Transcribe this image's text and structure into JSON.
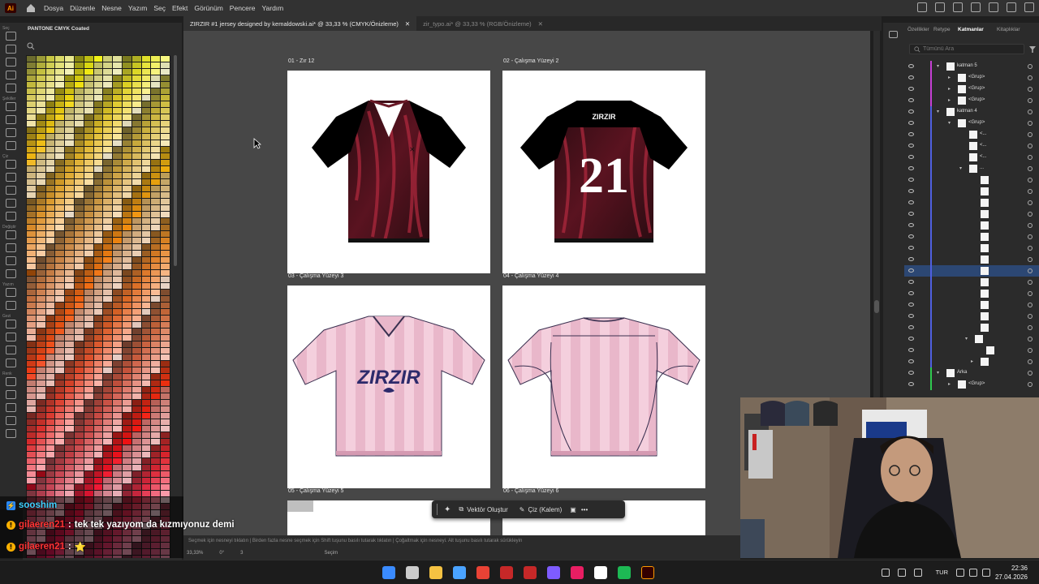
{
  "app": {
    "logo": "Ai"
  },
  "menu": [
    "Dosya",
    "Düzenle",
    "Nesne",
    "Yazım",
    "Seç",
    "Efekt",
    "Görünüm",
    "Pencere",
    "Yardım"
  ],
  "tabs": [
    {
      "label": "ZIRZIR #1 jersey designed by kemaldowski.ai* @ 33,33 % (CMYK/Önizleme)",
      "active": true
    },
    {
      "label": "zir_typo.ai* @ 33,33 % (RGB/Önizleme)",
      "active": false
    }
  ],
  "tool_labels": [
    "Seç",
    "Şekiller",
    "Çiz",
    "Değiştir",
    "Yazım",
    "Gezi",
    "Renk"
  ],
  "swatches": {
    "title": "PANTONE CMYK Coated"
  },
  "artboards": [
    {
      "label": "01 - Zır 12",
      "kind": "front-dark"
    },
    {
      "label": "02 - Çalışma Yüzeyi 2",
      "kind": "back-dark",
      "number": "21",
      "logo": "ZIRZIR"
    },
    {
      "label": "03 - Çalışma Yüzeyi 3",
      "kind": "front-pink",
      "logo": "ZIRZIR"
    },
    {
      "label": "04 - Çalışma Yüzeyi 4",
      "kind": "back-pink"
    },
    {
      "label": "05 - Çalışma Yüzeyi 5",
      "kind": "blank"
    },
    {
      "label": "06 - Çalışma Yüzeyi 6",
      "kind": "blank"
    }
  ],
  "float_toolbar": {
    "vector_label": "Vektör Oluştur",
    "draw_label": "Çiz (Kalem)"
  },
  "status": {
    "hint": "Seçmek için nesneyi tıklatın  |  Birden fazla nesne seçmek için Shift tuşunu basılı tutarak tıklatın  |  Çoğaltmak için nesneyi. Alt tuşunu basılı tutarak sürükleyin",
    "zoom": "33,33%",
    "angle": "0°",
    "artboard_index": "3",
    "mode": "Seçim"
  },
  "layers_panel": {
    "tabs": [
      "Özellikler",
      "Retype",
      "Katmanlar",
      "Kitaplıklar"
    ],
    "active_tab": "Katmanlar",
    "search_placeholder": "Tümünü Ara",
    "rows": [
      {
        "name": "katman 5",
        "indent": 0,
        "color": "#c63fd4",
        "arrow": "v",
        "thumb": true
      },
      {
        "name": "<Grup>",
        "indent": 2,
        "color": "#c63fd4",
        "arrow": ">",
        "thumb": true
      },
      {
        "name": "<Grup>",
        "indent": 2,
        "color": "#c63fd4",
        "arrow": ">",
        "thumb": true
      },
      {
        "name": "<Grup>",
        "indent": 2,
        "color": "#c63fd4",
        "arrow": ">",
        "thumb": true
      },
      {
        "name": "katman 4",
        "indent": 0,
        "color": "#4f5fe0",
        "arrow": "v",
        "thumb": true
      },
      {
        "name": "<Grup>",
        "indent": 2,
        "color": "#4f5fe0",
        "arrow": "v",
        "thumb": true
      },
      {
        "name": "<...",
        "indent": 4,
        "color": "#4f5fe0",
        "arrow": "",
        "thumb": true
      },
      {
        "name": "<...",
        "indent": 4,
        "color": "#4f5fe0",
        "arrow": "",
        "thumb": true
      },
      {
        "name": "<...",
        "indent": 4,
        "color": "#4f5fe0",
        "arrow": "",
        "thumb": true
      },
      {
        "name": "...",
        "indent": 4,
        "color": "#4f5fe0",
        "arrow": "v",
        "thumb": true
      },
      {
        "name": "",
        "indent": 6,
        "color": "#4f5fe0",
        "arrow": "",
        "thumb": true
      },
      {
        "name": "",
        "indent": 6,
        "color": "#4f5fe0",
        "arrow": "",
        "thumb": true
      },
      {
        "name": "",
        "indent": 6,
        "color": "#4f5fe0",
        "arrow": "",
        "thumb": true
      },
      {
        "name": "",
        "indent": 6,
        "color": "#4f5fe0",
        "arrow": "",
        "thumb": true
      },
      {
        "name": "",
        "indent": 6,
        "color": "#4f5fe0",
        "arrow": "",
        "thumb": true
      },
      {
        "name": "",
        "indent": 6,
        "color": "#4f5fe0",
        "arrow": "",
        "thumb": true
      },
      {
        "name": "",
        "indent": 6,
        "color": "#4f5fe0",
        "arrow": "",
        "thumb": true
      },
      {
        "name": "",
        "indent": 6,
        "color": "#4f5fe0",
        "arrow": "",
        "thumb": true
      },
      {
        "name": "",
        "indent": 6,
        "color": "#4f5fe0",
        "arrow": "",
        "thumb": true,
        "selected": true
      },
      {
        "name": "",
        "indent": 6,
        "color": "#4f5fe0",
        "arrow": "",
        "thumb": true
      },
      {
        "name": "",
        "indent": 6,
        "color": "#4f5fe0",
        "arrow": "",
        "thumb": true
      },
      {
        "name": "",
        "indent": 6,
        "color": "#4f5fe0",
        "arrow": "",
        "thumb": true
      },
      {
        "name": "",
        "indent": 6,
        "color": "#4f5fe0",
        "arrow": "",
        "thumb": true
      },
      {
        "name": "",
        "indent": 6,
        "color": "#4f5fe0",
        "arrow": "",
        "thumb": true
      },
      {
        "name": "",
        "indent": 5,
        "color": "#4f5fe0",
        "arrow": "v",
        "thumb": true
      },
      {
        "name": "",
        "indent": 7,
        "color": "#4f5fe0",
        "arrow": "",
        "thumb": true
      },
      {
        "name": "",
        "indent": 6,
        "color": "#4f5fe0",
        "arrow": ">",
        "thumb": true
      },
      {
        "name": "Arka",
        "indent": 0,
        "color": "#2fc84f",
        "arrow": "v",
        "thumb": true
      },
      {
        "name": "<Grup>",
        "indent": 2,
        "color": "#2fc84f",
        "arrow": ">",
        "thumb": true
      }
    ]
  },
  "chat": [
    {
      "user": "sooshim",
      "badge": "",
      "message": ""
    },
    {
      "user": "gilaeren21",
      "badge": "!",
      "message": "tek tek yazıyom da kızmıyonuz demi"
    },
    {
      "user": "gilaeren21",
      "badge": "!",
      "message": "⭐"
    }
  ],
  "taskbar": {
    "language": "TUR",
    "time": "22:36",
    "date": "27.04.2026",
    "apps": [
      "windows-start",
      "search",
      "file-explorer",
      "photos",
      "chrome",
      "game-a",
      "game-b",
      "affinity",
      "media",
      "notion",
      "spotify",
      "illustrator"
    ]
  },
  "colors": {
    "accent": "#4f5fe0",
    "jersey_dark": "#000000",
    "jersey_flame": "#8a1c2c",
    "jersey_pink": "#f1c6d6",
    "jersey_logo": "#2d2a6b"
  }
}
